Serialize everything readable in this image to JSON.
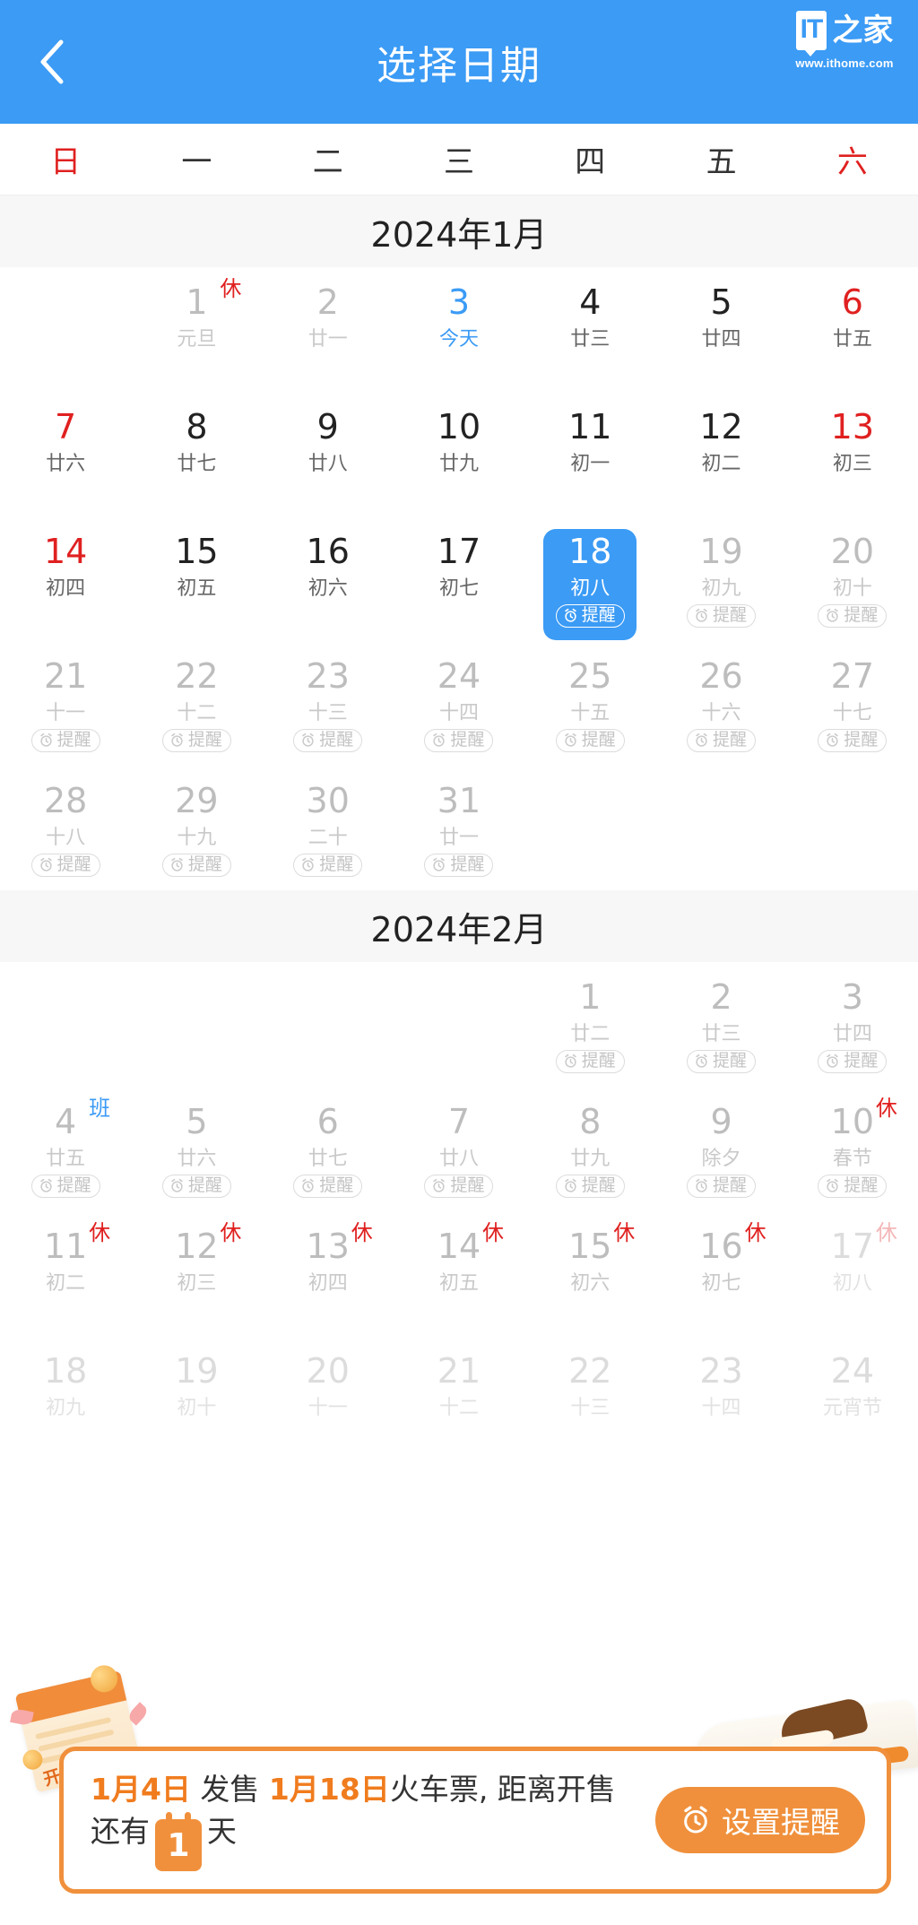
{
  "header": {
    "title": "选择日期",
    "back_icon": "chevron-left-icon",
    "logo": {
      "mark": "IT",
      "cn": "之家",
      "url": "www.ithome.com"
    }
  },
  "weekdays": [
    {
      "label": "日",
      "red": true
    },
    {
      "label": "一",
      "red": false
    },
    {
      "label": "二",
      "red": false
    },
    {
      "label": "三",
      "red": false
    },
    {
      "label": "四",
      "red": false
    },
    {
      "label": "五",
      "red": false
    },
    {
      "label": "六",
      "red": true
    }
  ],
  "reminder_pill_label": "提醒",
  "months": [
    {
      "title": "2024年1月",
      "days": [
        {
          "blank": true
        },
        {
          "num": "1",
          "lunar": "元旦",
          "style": "gray",
          "badge": "休",
          "badge_type": "rest"
        },
        {
          "num": "2",
          "lunar": "廿一",
          "style": "gray"
        },
        {
          "num": "3",
          "lunar": "今天",
          "style": "today"
        },
        {
          "num": "4",
          "lunar": "廿三",
          "style": "normal"
        },
        {
          "num": "5",
          "lunar": "廿四",
          "style": "normal"
        },
        {
          "num": "6",
          "lunar": "廿五",
          "style": "red"
        },
        {
          "num": "7",
          "lunar": "廿六",
          "style": "red"
        },
        {
          "num": "8",
          "lunar": "廿七",
          "style": "normal"
        },
        {
          "num": "9",
          "lunar": "廿八",
          "style": "normal"
        },
        {
          "num": "10",
          "lunar": "廿九",
          "style": "normal"
        },
        {
          "num": "11",
          "lunar": "初一",
          "style": "normal"
        },
        {
          "num": "12",
          "lunar": "初二",
          "style": "normal"
        },
        {
          "num": "13",
          "lunar": "初三",
          "style": "red"
        },
        {
          "num": "14",
          "lunar": "初四",
          "style": "red"
        },
        {
          "num": "15",
          "lunar": "初五",
          "style": "normal"
        },
        {
          "num": "16",
          "lunar": "初六",
          "style": "normal"
        },
        {
          "num": "17",
          "lunar": "初七",
          "style": "normal"
        },
        {
          "num": "18",
          "lunar": "初八",
          "style": "selected",
          "pill": true
        },
        {
          "num": "19",
          "lunar": "初九",
          "style": "gray",
          "pill": true
        },
        {
          "num": "20",
          "lunar": "初十",
          "style": "gray",
          "pill": true
        },
        {
          "num": "21",
          "lunar": "十一",
          "style": "gray",
          "pill": true
        },
        {
          "num": "22",
          "lunar": "十二",
          "style": "gray",
          "pill": true
        },
        {
          "num": "23",
          "lunar": "十三",
          "style": "gray",
          "pill": true
        },
        {
          "num": "24",
          "lunar": "十四",
          "style": "gray",
          "pill": true
        },
        {
          "num": "25",
          "lunar": "十五",
          "style": "gray",
          "pill": true
        },
        {
          "num": "26",
          "lunar": "十六",
          "style": "gray",
          "pill": true
        },
        {
          "num": "27",
          "lunar": "十七",
          "style": "gray",
          "pill": true
        },
        {
          "num": "28",
          "lunar": "十八",
          "style": "gray",
          "pill": true
        },
        {
          "num": "29",
          "lunar": "十九",
          "style": "gray",
          "pill": true
        },
        {
          "num": "30",
          "lunar": "二十",
          "style": "gray",
          "pill": true
        },
        {
          "num": "31",
          "lunar": "廿一",
          "style": "gray",
          "pill": true
        },
        {
          "blank": true
        },
        {
          "blank": true
        },
        {
          "blank": true
        }
      ]
    },
    {
      "title": "2024年2月",
      "days": [
        {
          "blank": true
        },
        {
          "blank": true
        },
        {
          "blank": true
        },
        {
          "blank": true
        },
        {
          "num": "1",
          "lunar": "廿二",
          "style": "gray",
          "pill": true
        },
        {
          "num": "2",
          "lunar": "廿三",
          "style": "gray",
          "pill": true
        },
        {
          "num": "3",
          "lunar": "廿四",
          "style": "gray",
          "pill": true
        },
        {
          "num": "4",
          "lunar": "廿五",
          "style": "gray",
          "pill": true,
          "badge": "班",
          "badge_type": "work"
        },
        {
          "num": "5",
          "lunar": "廿六",
          "style": "gray",
          "pill": true
        },
        {
          "num": "6",
          "lunar": "廿七",
          "style": "gray",
          "pill": true
        },
        {
          "num": "7",
          "lunar": "廿八",
          "style": "gray",
          "pill": true
        },
        {
          "num": "8",
          "lunar": "廿九",
          "style": "gray",
          "pill": true
        },
        {
          "num": "9",
          "lunar": "除夕",
          "style": "gray",
          "pill": true
        },
        {
          "num": "10",
          "lunar": "春节",
          "style": "gray",
          "pill": true,
          "badge": "休",
          "badge_type": "rest"
        },
        {
          "num": "11",
          "lunar": "初二",
          "style": "gray",
          "badge": "休",
          "badge_type": "rest"
        },
        {
          "num": "12",
          "lunar": "初三",
          "style": "gray",
          "badge": "休",
          "badge_type": "rest"
        },
        {
          "num": "13",
          "lunar": "初四",
          "style": "gray",
          "badge": "休",
          "badge_type": "rest"
        },
        {
          "num": "14",
          "lunar": "初五",
          "style": "gray",
          "badge": "休",
          "badge_type": "rest"
        },
        {
          "num": "15",
          "lunar": "初六",
          "style": "gray",
          "badge": "休",
          "badge_type": "rest"
        },
        {
          "num": "16",
          "lunar": "初七",
          "style": "gray",
          "badge": "休",
          "badge_type": "rest"
        },
        {
          "num": "17",
          "lunar": "初八",
          "style": "xgray",
          "badge": "休",
          "badge_type": "rest-faded"
        },
        {
          "num": "18",
          "lunar": "初九",
          "style": "xgray"
        },
        {
          "num": "19",
          "lunar": "初十",
          "style": "xgray"
        },
        {
          "num": "20",
          "lunar": "十一",
          "style": "xgray"
        },
        {
          "num": "21",
          "lunar": "十二",
          "style": "xgray"
        },
        {
          "num": "22",
          "lunar": "十三",
          "style": "xgray"
        },
        {
          "num": "23",
          "lunar": "十四",
          "style": "xgray"
        },
        {
          "num": "24",
          "lunar": "元宵节",
          "style": "xgray"
        }
      ]
    }
  ],
  "banner": {
    "sale_date": "1月4日",
    "sale_verb": " 发售 ",
    "ticket_date": "1月18日",
    "ticket_text": "火车票, 距离开售",
    "countdown_prefix": "还有",
    "countdown_days": "1",
    "countdown_suffix": "天",
    "button_label": "设置提醒",
    "button_icon": "alarm-clock-icon",
    "deco_stamp": "开售",
    "accent_color": "#f0903c"
  }
}
